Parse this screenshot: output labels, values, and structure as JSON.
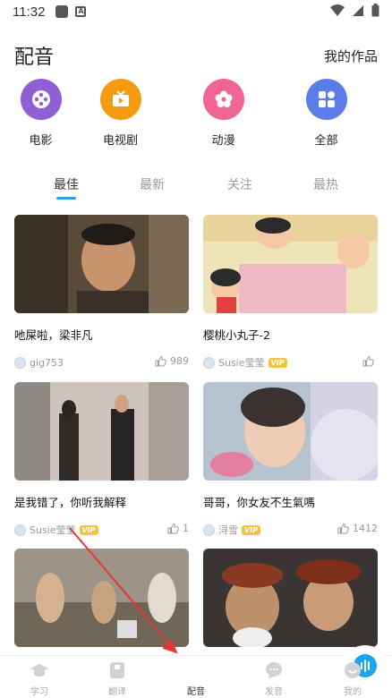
{
  "status_bar": {
    "time": "11:32"
  },
  "header": {
    "title": "配音",
    "my_works": "我的作品"
  },
  "categories": [
    {
      "label": "电影",
      "color": "#8f5fd6"
    },
    {
      "label": "电视剧",
      "color": "#f59b12"
    },
    {
      "label": "动漫",
      "color": "#f06595"
    },
    {
      "label": "全部",
      "color": "#5c7de8"
    }
  ],
  "tabs": [
    "最佳",
    "最新",
    "关注",
    "最热"
  ],
  "cards": [
    {
      "title": "吔屎啦，梁非凡",
      "user": "gig753",
      "vip": "",
      "likes": "989"
    },
    {
      "title": "樱桃小丸子-2",
      "user": "Susie莹莹",
      "vip": "VIP",
      "likes": ""
    },
    {
      "title": "是我错了，你听我解释",
      "user": "Susie莹莹",
      "vip": "VIP",
      "likes": "1"
    },
    {
      "title": "哥哥，你女友不生氣嗎",
      "user": "浔雪",
      "vip": "VIP",
      "likes": "1412"
    }
  ],
  "tabbar": [
    {
      "label": "学习"
    },
    {
      "label": "翻译"
    },
    {
      "label": "配音"
    },
    {
      "label": "发音"
    },
    {
      "label": "我的"
    }
  ],
  "colors": {
    "accent": "#1ea5e9",
    "annotation_arrow": "#e53935"
  }
}
